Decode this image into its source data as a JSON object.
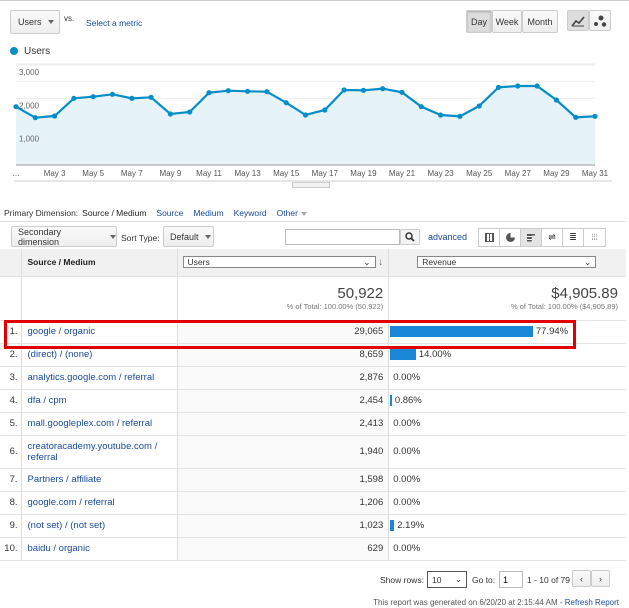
{
  "toolbar": {
    "metric": "Users",
    "vs": "vs.",
    "select_metric": "Select a metric",
    "day": "Day",
    "week": "Week",
    "month": "Month",
    "line_chart_icon": "line-chart-icon",
    "motion_chart_icon": "motion-chart-icon"
  },
  "chart_data": {
    "type": "area",
    "legend": "Users",
    "legend_placement": "top-left",
    "color": "#058dc7",
    "fill": "#e6f3f9",
    "x": [
      "May 1",
      "May 2",
      "May 3",
      "May 4",
      "May 5",
      "May 6",
      "May 7",
      "May 8",
      "May 9",
      "May 10",
      "May 11",
      "May 12",
      "May 13",
      "May 14",
      "May 15",
      "May 16",
      "May 17",
      "May 18",
      "May 19",
      "May 20",
      "May 21",
      "May 22",
      "May 23",
      "May 24",
      "May 25",
      "May 26",
      "May 27",
      "May 28",
      "May 29",
      "May 30",
      "May 31"
    ],
    "values": [
      1750,
      1420,
      1470,
      2000,
      2050,
      2120,
      2000,
      2030,
      1530,
      1590,
      2170,
      2230,
      2210,
      2200,
      1870,
      1500,
      1650,
      2250,
      2240,
      2290,
      2180,
      1750,
      1500,
      1460,
      1770,
      2330,
      2370,
      2370,
      1950,
      1430,
      1460
    ],
    "x_tick_labels": [
      "...",
      "May 3",
      "May 5",
      "May 7",
      "May 9",
      "May 11",
      "May 13",
      "May 15",
      "May 17",
      "May 19",
      "May 21",
      "May 23",
      "May 25",
      "May 27",
      "May 29",
      "May 31"
    ],
    "y_tick_labels": [
      "3,000",
      "2,000",
      "1,000"
    ],
    "ylim": [
      0,
      3000
    ],
    "grid": true
  },
  "dimension": {
    "label": "Primary Dimension:",
    "active": "Source / Medium",
    "options": [
      "Source",
      "Medium",
      "Keyword",
      "Other"
    ]
  },
  "controls": {
    "secondary": "Secondary dimension",
    "sort_label": "Sort Type:",
    "sort_value": "Default",
    "search_value": "",
    "advanced": "advanced"
  },
  "table": {
    "headers": {
      "source": "Source / Medium",
      "users": "Users",
      "revenue": "Revenue"
    },
    "totals": {
      "users": "50,922",
      "users_pct": "% of Total: 100.00% (50,922)",
      "revenue": "$4,905.89",
      "revenue_pct": "% of Total: 100.00% ($4,905.89)"
    },
    "rows": [
      {
        "n": "1.",
        "source": "google / organic",
        "users": "29,065",
        "revenue_pct": "77.94%",
        "bar": 77.94
      },
      {
        "n": "2.",
        "source": "(direct) / (none)",
        "users": "8,659",
        "revenue_pct": "14.00%",
        "bar": 14.0
      },
      {
        "n": "3.",
        "source": "analytics.google.com / referral",
        "users": "2,876",
        "revenue_pct": "0.00%",
        "bar": 0
      },
      {
        "n": "4.",
        "source": "dfa / cpm",
        "users": "2,454",
        "revenue_pct": "0.86%",
        "bar": 0.86
      },
      {
        "n": "5.",
        "source": "mall.googleplex.com / referral",
        "users": "2,413",
        "revenue_pct": "0.00%",
        "bar": 0
      },
      {
        "n": "6.",
        "source": "creatoracademy.youtube.com / referral",
        "users": "1,940",
        "revenue_pct": "0.00%",
        "bar": 0
      },
      {
        "n": "7.",
        "source": "Partners / affiliate",
        "users": "1,598",
        "revenue_pct": "0.00%",
        "bar": 0
      },
      {
        "n": "8.",
        "source": "google.com / referral",
        "users": "1,206",
        "revenue_pct": "0.00%",
        "bar": 0
      },
      {
        "n": "9.",
        "source": "(not set) / (not set)",
        "users": "1,023",
        "revenue_pct": "2.19%",
        "bar": 2.19
      },
      {
        "n": "10.",
        "source": "baidu / organic",
        "users": "629",
        "revenue_pct": "0.00%",
        "bar": 0
      }
    ],
    "highlight_row": 1,
    "highlight_color": "#e00000"
  },
  "pagination": {
    "show_rows_label": "Show rows:",
    "show_rows": "10",
    "goto_label": "Go to:",
    "goto": "1",
    "range": "1 - 10 of 79"
  },
  "footer": {
    "generated": "This report was generated on 6/20/20 at 2:15:44 AM - ",
    "refresh": "Refresh Report"
  }
}
